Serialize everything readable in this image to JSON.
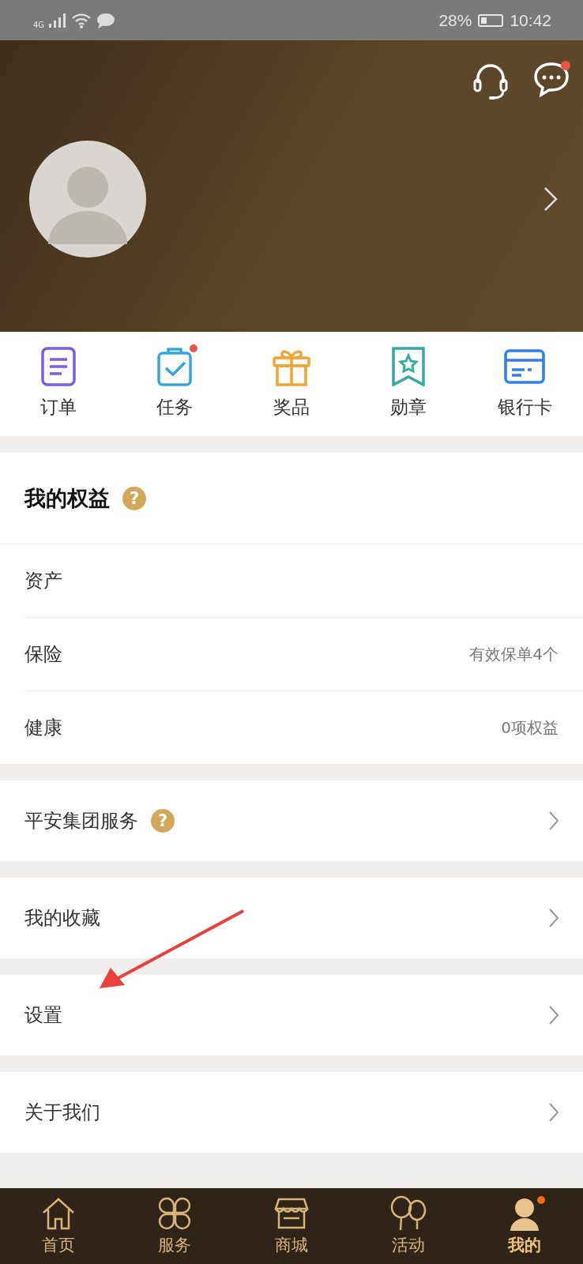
{
  "status_bar": {
    "network": "4G",
    "battery": "28%",
    "time": "10:42"
  },
  "header": {
    "messages_unread": true
  },
  "shortcuts": [
    {
      "label": "订单",
      "kind": "order",
      "dot": false
    },
    {
      "label": "任务",
      "kind": "task",
      "dot": true
    },
    {
      "label": "奖品",
      "kind": "gift",
      "dot": false
    },
    {
      "label": "勋章",
      "kind": "medal",
      "dot": false
    },
    {
      "label": "银行卡",
      "kind": "card",
      "dot": false
    }
  ],
  "benefits": {
    "title": "我的权益",
    "help": "?",
    "rows": [
      {
        "label": "资产"
      },
      {
        "label": "保险",
        "value": "有效保单4个"
      },
      {
        "label": "健康",
        "value": "0项权益"
      }
    ]
  },
  "menu_groups": [
    {
      "label": "平安集团服务",
      "help": "?"
    },
    {
      "label": "我的收藏"
    },
    {
      "label": "设置",
      "annotated": true
    },
    {
      "label": "关于我们"
    }
  ],
  "tab_bar": [
    {
      "label": "首页",
      "kind": "home",
      "selected": false
    },
    {
      "label": "服务",
      "kind": "service",
      "selected": false
    },
    {
      "label": "商城",
      "kind": "shop",
      "selected": false
    },
    {
      "label": "活动",
      "kind": "event",
      "selected": false
    },
    {
      "label": "我的",
      "kind": "me",
      "selected": true,
      "dot": true
    }
  ]
}
